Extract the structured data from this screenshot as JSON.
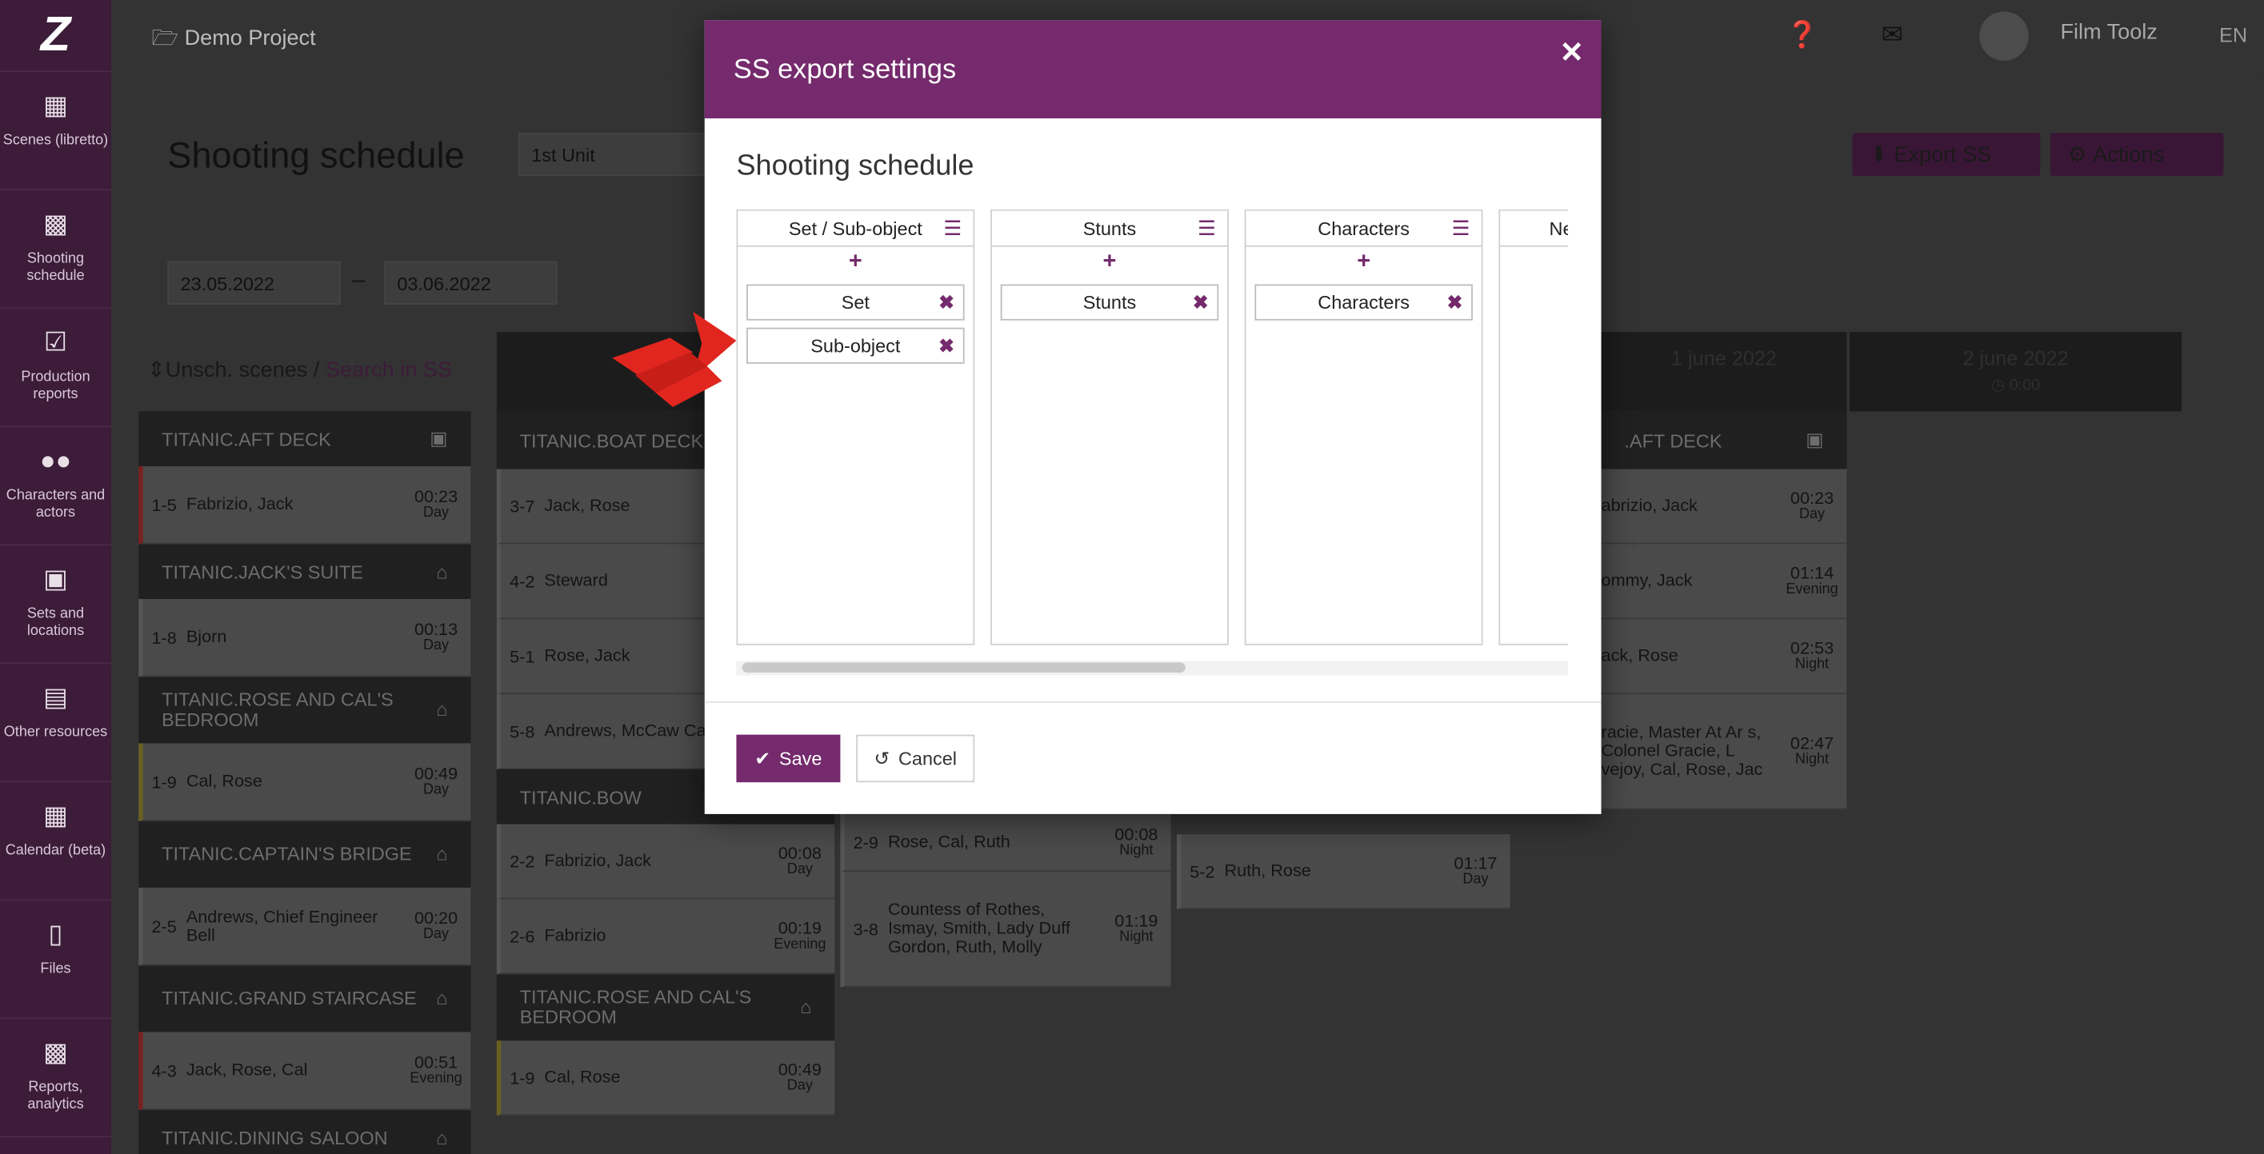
{
  "topbar": {
    "project": "Demo Project",
    "user": "Film Toolz",
    "lang": "EN"
  },
  "nav": [
    {
      "label": "Scenes (libretto)"
    },
    {
      "label": "Shooting schedule"
    },
    {
      "label": "Production reports"
    },
    {
      "label": "Characters and actors"
    },
    {
      "label": "Sets and locations"
    },
    {
      "label": "Other resources"
    },
    {
      "label": "Calendar (beta)"
    },
    {
      "label": "Files"
    },
    {
      "label": "Reports, analytics"
    }
  ],
  "page": {
    "title": "Shooting schedule",
    "unit": "1st Unit",
    "export_label": "Export SS",
    "actions_label": "Actions",
    "date_from": "23.05.2022",
    "date_to": "03.06.2022",
    "unscheduled": "Unsch. scenes",
    "search_in": "Search in SS"
  },
  "unscheduled_groups": [
    {
      "name": "TITANIC.AFT DECK",
      "rows": [
        {
          "n": "1-5",
          "chars": "Fabrizio, Jack",
          "time": "00:23",
          "tod": "Day"
        }
      ]
    },
    {
      "name": "TITANIC.JACK'S SUITE",
      "rows": [
        {
          "n": "1-8",
          "chars": "Bjorn",
          "time": "00:13",
          "tod": "Day"
        }
      ]
    },
    {
      "name": "TITANIC.ROSE AND CAL'S BEDROOM",
      "rows": [
        {
          "n": "1-9",
          "chars": "Cal, Rose",
          "time": "00:49",
          "tod": "Day"
        }
      ]
    },
    {
      "name": "TITANIC.CAPTAIN'S BRIDGE",
      "rows": [
        {
          "n": "2-5",
          "chars": "Andrews, Chief Engineer Bell",
          "time": "00:20",
          "tod": "Day"
        }
      ]
    },
    {
      "name": "TITANIC.GRAND STAIRCASE",
      "rows": [
        {
          "n": "4-3",
          "chars": "Jack, Rose, Cal",
          "time": "00:51",
          "tod": "Evening"
        }
      ]
    },
    {
      "name": "TITANIC.DINING SALOON",
      "rows": []
    }
  ],
  "day1": {
    "groups": [
      {
        "name": "TITANIC.BOAT DECK",
        "rows": [
          {
            "n": "3-7",
            "chars": "Jack, Rose"
          },
          {
            "n": "4-2",
            "chars": "Steward"
          },
          {
            "n": "5-1",
            "chars": "Rose, Jack"
          },
          {
            "n": "5-8",
            "chars": "Andrews, McCaw Cal, Rose"
          }
        ]
      },
      {
        "name": "TITANIC.BOW",
        "rows": [
          {
            "n": "2-2",
            "chars": "Fabrizio, Jack",
            "time": "00:08",
            "tod": "Day"
          },
          {
            "n": "2-6",
            "chars": "Fabrizio",
            "time": "00:19",
            "tod": "Evening"
          }
        ]
      },
      {
        "name": "TITANIC.ROSE AND CAL'S BEDROOM",
        "rows": [
          {
            "n": "1-9",
            "chars": "Cal, Rose",
            "time": "00:49",
            "tod": "Day"
          }
        ]
      }
    ]
  },
  "day2": {
    "rows": [
      {
        "n": "2-9",
        "chars": "Rose, Cal, Ruth",
        "time": "00:08",
        "tod": "Night"
      },
      {
        "n": "3-8",
        "chars": "Countess of Rothes, Ismay, Smith, Lady Duff Gordon, Ruth, Molly",
        "time": "01:19",
        "tod": "Night"
      }
    ]
  },
  "day3": {
    "rows": [
      {
        "n": "5-2",
        "chars": "Ruth, Rose",
        "time": "01:17",
        "tod": "Day"
      }
    ]
  },
  "day_june1": {
    "header": "1 june 2022",
    "group": ".AFT DECK",
    "rows": [
      {
        "chars": "abrizio, Jack",
        "time": "00:23",
        "tod": "Day"
      },
      {
        "chars": "ommy, Jack",
        "time": "01:14",
        "tod": "Evening"
      },
      {
        "chars": "ack, Rose",
        "time": "02:53",
        "tod": "Night"
      },
      {
        "chars": "racie, Master At Ar s, Colonel Gracie, L vejoy, Cal, Rose, Jac",
        "time": "02:47",
        "tod": "Night"
      }
    ]
  },
  "day_june2": {
    "header": "2 june 2022",
    "meta": "0:00"
  },
  "modal": {
    "title": "SS export settings",
    "subtitle": "Shooting schedule",
    "columns": [
      {
        "title": "Set / Sub-object",
        "items": [
          "Set",
          "Sub-object"
        ]
      },
      {
        "title": "Stunts",
        "items": [
          "Stunts"
        ]
      },
      {
        "title": "Characters",
        "items": [
          "Characters"
        ]
      },
      {
        "title": "Ne",
        "items": []
      }
    ],
    "save_label": "Save",
    "cancel_label": "Cancel"
  },
  "colors": {
    "accent": "#742a6c",
    "nav_bg": "#3c1c39"
  }
}
